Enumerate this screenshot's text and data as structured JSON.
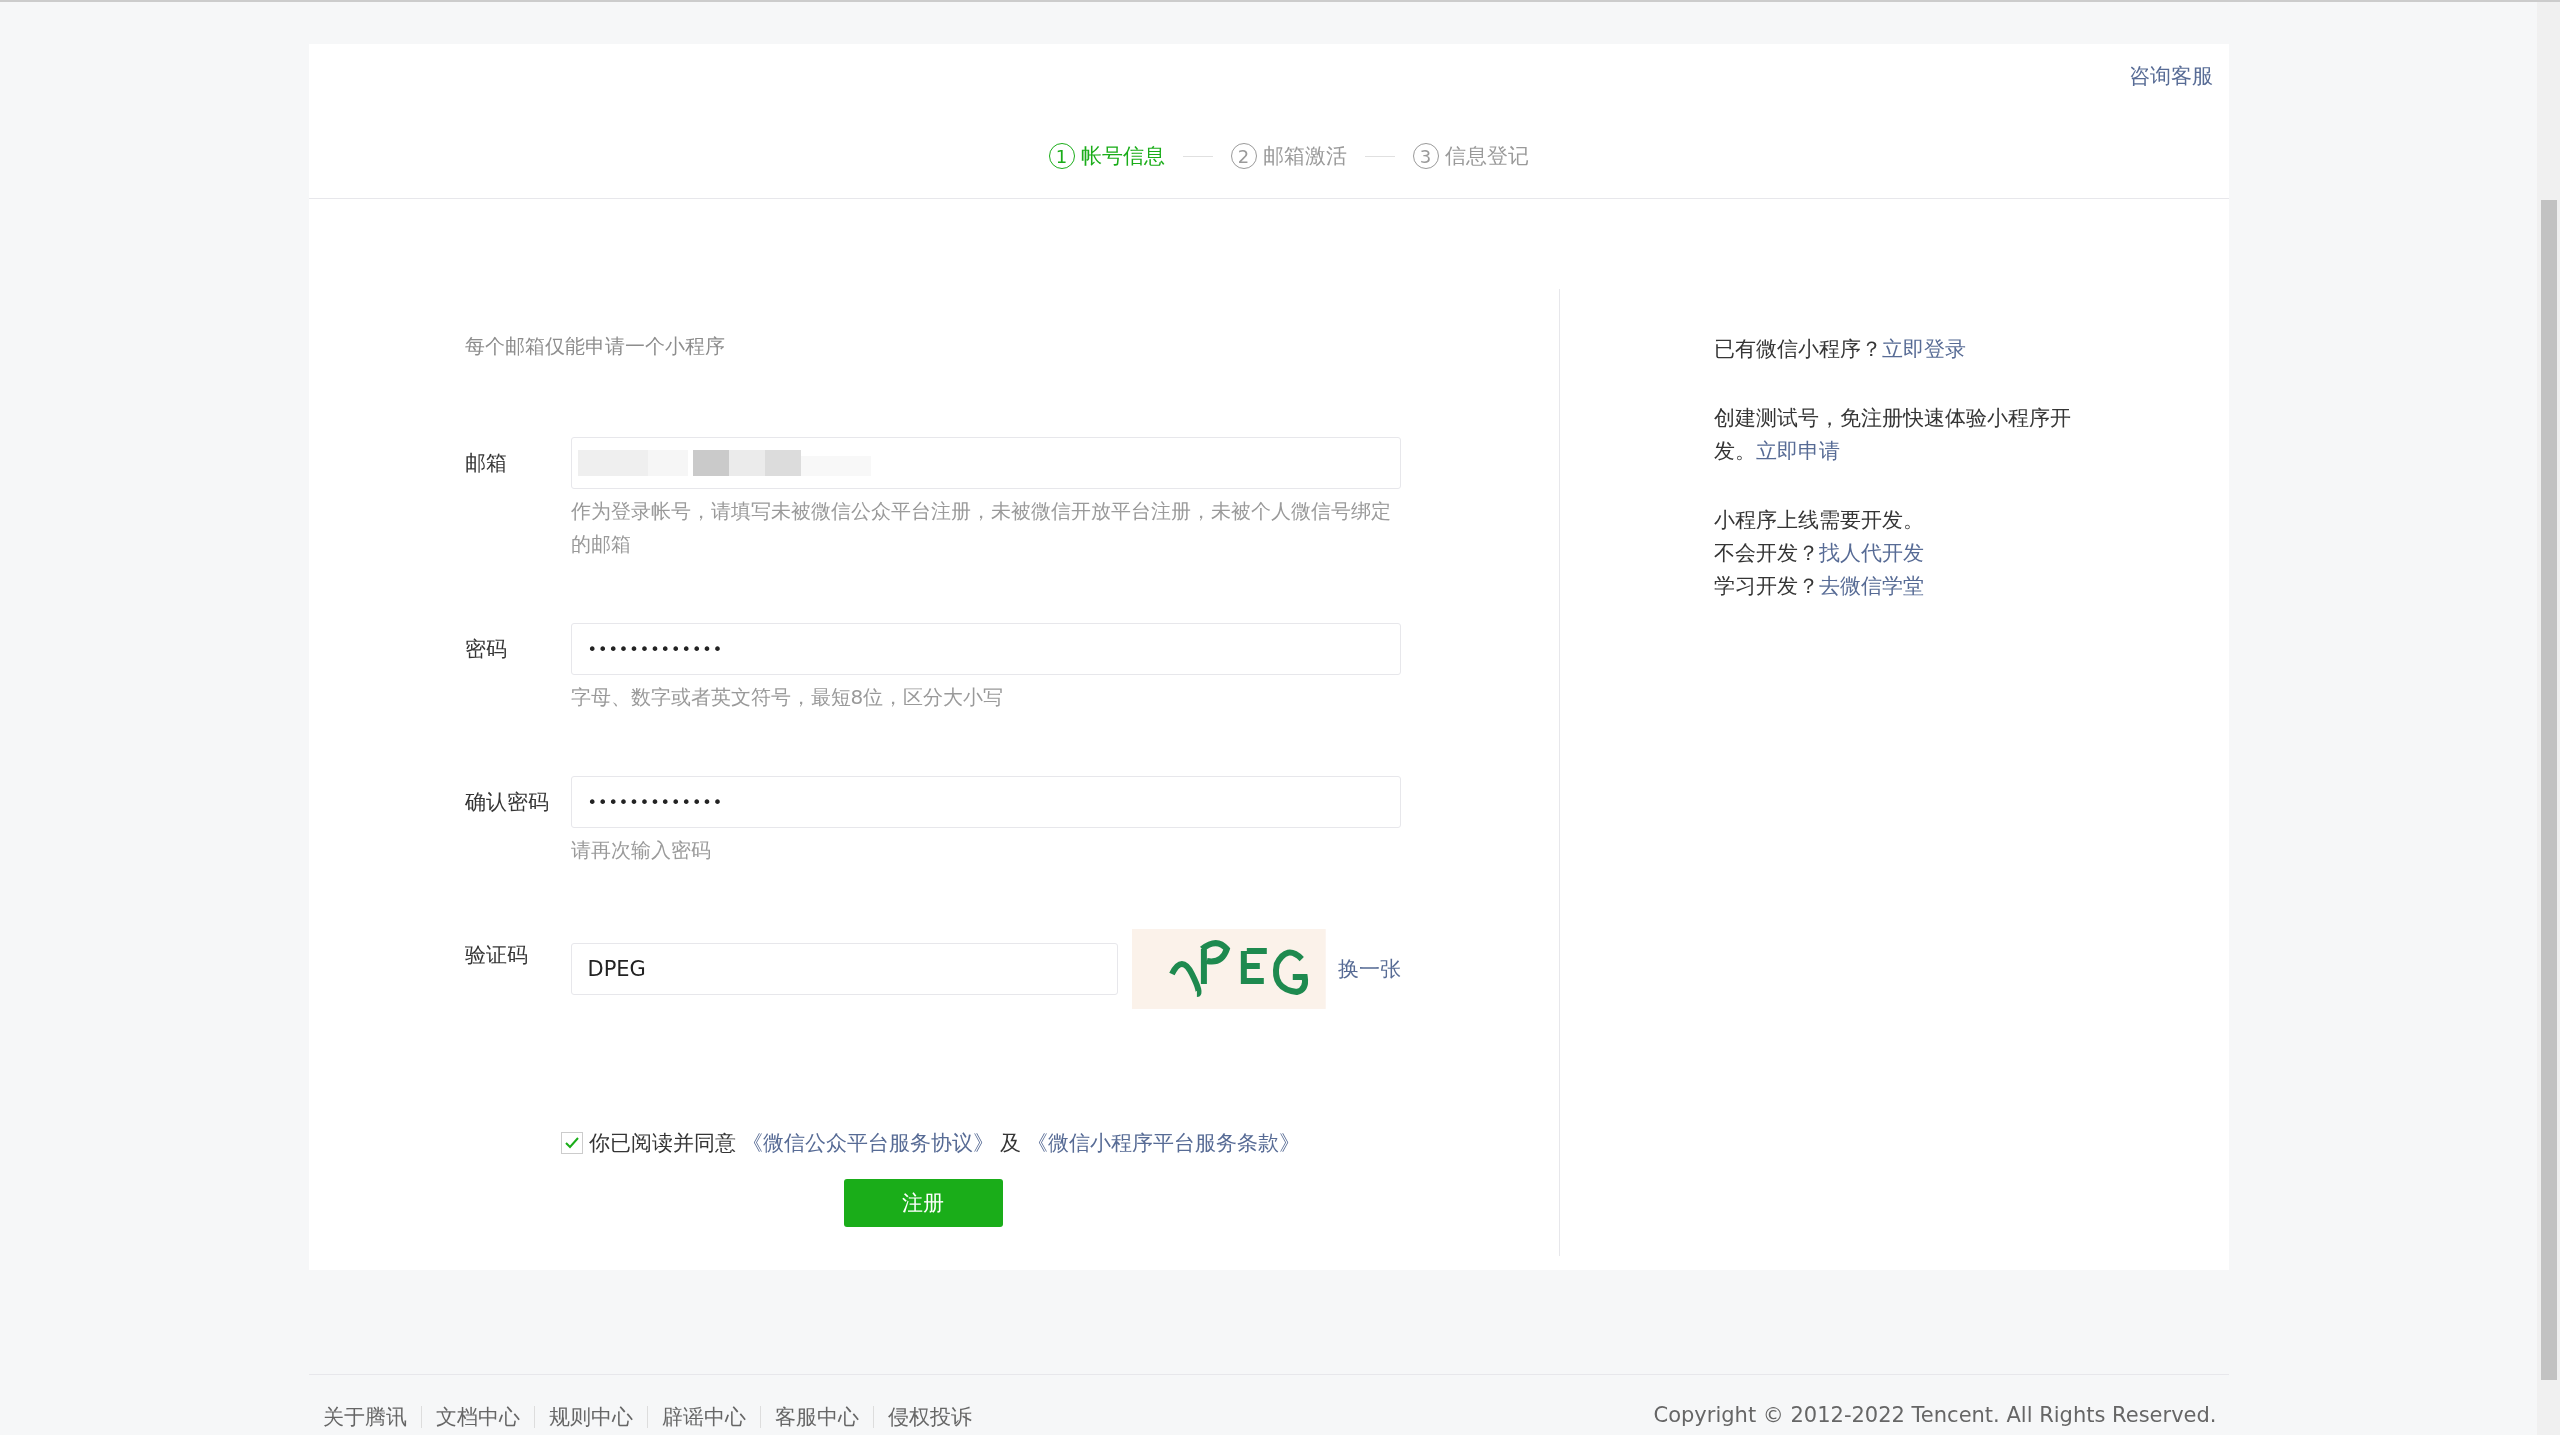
{
  "header": {
    "help_link": "咨询客服",
    "steps": [
      {
        "number": "1",
        "label": "帐号信息",
        "selected": true
      },
      {
        "number": "2",
        "label": "邮箱激活",
        "selected": false
      },
      {
        "number": "3",
        "label": "信息登记",
        "selected": false
      }
    ]
  },
  "form": {
    "notice": "每个邮箱仅能申请一个小程序",
    "fields": [
      {
        "kind": "email",
        "label": "邮箱",
        "redacted": true,
        "hint": "作为登录帐号，请填写未被微信公众平台注册，未被微信开放平台注册，未被个人微信号绑定的邮箱"
      },
      {
        "kind": "password",
        "label": "密码",
        "value": "•••••••••••••",
        "hint": "字母、数字或者英文符号，最短8位，区分大小写"
      },
      {
        "kind": "password",
        "label": "确认密码",
        "value": "•••••••••••••",
        "hint": "请再次输入密码"
      },
      {
        "kind": "captcha",
        "label": "验证码",
        "value": "DPEG",
        "refresh_link": "换一张"
      }
    ],
    "agreement": {
      "checked": true,
      "text": "你已阅读并同意",
      "link_1": "《微信公众平台服务协议》",
      "joiner": "及",
      "link_2": "《微信小程序平台服务条款》"
    },
    "submit": "注册"
  },
  "sidebar": {
    "login_prompt": "已有微信小程序？",
    "login_link": "立即登录",
    "test_text": "创建测试号，免注册快速体验小程序开发。",
    "test_link": "立即申请",
    "dev_text": "小程序上线需要开发。",
    "dev_lines": [
      {
        "text": "不会开发？",
        "link": "找人代开发"
      },
      {
        "text": "学习开发？",
        "link": "去微信学堂"
      }
    ]
  },
  "footer": {
    "links": [
      "关于腾讯",
      "文档中心",
      "规则中心",
      "辟谣中心",
      "客服中心",
      "侵权投诉"
    ],
    "copyright": "Copyright © 2012-2022 Tencent. All Rights Reserved."
  }
}
